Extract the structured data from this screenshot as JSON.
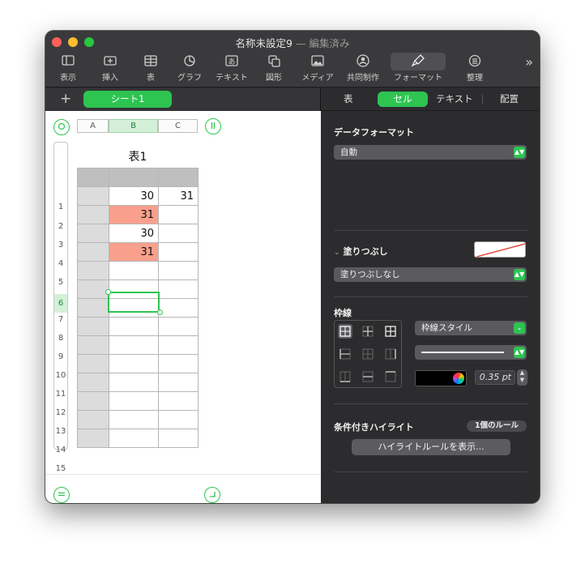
{
  "window": {
    "title": "名称未設定9",
    "title_suffix": " — 編集済み"
  },
  "toolbar": {
    "items": [
      {
        "label": "表示",
        "icon": "sidebar-view-icon"
      },
      {
        "label": "挿入",
        "icon": "insert-icon"
      },
      {
        "label": "表",
        "icon": "table-icon"
      },
      {
        "label": "グラフ",
        "icon": "chart-icon"
      },
      {
        "label": "テキスト",
        "icon": "text-icon"
      },
      {
        "label": "図形",
        "icon": "shape-icon"
      },
      {
        "label": "メディア",
        "icon": "media-icon"
      },
      {
        "label": "共同制作",
        "icon": "collaborate-icon"
      },
      {
        "label": "フォーマット",
        "icon": "format-brush-icon"
      },
      {
        "label": "整理",
        "icon": "organize-icon"
      }
    ],
    "more": "»"
  },
  "sheets": {
    "add": "+",
    "active_sheet": "シート1"
  },
  "table": {
    "title": "表1",
    "columns": [
      "A",
      "B",
      "C"
    ],
    "selected_column": "B",
    "rows": [
      "1",
      "2",
      "3",
      "4",
      "5",
      "6",
      "7",
      "8",
      "9",
      "10",
      "11",
      "12",
      "13",
      "14",
      "15"
    ],
    "selected_row": "6",
    "cells": [
      [
        "",
        "",
        ""
      ],
      [
        "",
        "30",
        "31"
      ],
      [
        "",
        "31",
        ""
      ],
      [
        "",
        "30",
        ""
      ],
      [
        "",
        "31",
        ""
      ],
      [
        "",
        "",
        ""
      ],
      [
        "",
        "",
        ""
      ],
      [
        "",
        "",
        ""
      ],
      [
        "",
        "",
        ""
      ],
      [
        "",
        "",
        ""
      ],
      [
        "",
        "",
        ""
      ],
      [
        "",
        "",
        ""
      ],
      [
        "",
        "",
        ""
      ],
      [
        "",
        "",
        ""
      ],
      [
        "",
        "",
        ""
      ]
    ],
    "highlighted_cells": [
      "B3",
      "B5"
    ],
    "highlight_color": "#f9a08c"
  },
  "inspector": {
    "tabs": [
      "表",
      "セル",
      "テキスト",
      "配置"
    ],
    "active_tab": "セル",
    "data_format": {
      "label": "データフォーマット",
      "value": "自動"
    },
    "fill": {
      "label": "塗りつぶし",
      "value": "塗りつぶしなし"
    },
    "border": {
      "label": "枠線",
      "style": "枠線スタイル",
      "width": "0.35 pt",
      "color": "#000000"
    },
    "conditional": {
      "label": "条件付きハイライト",
      "badge": "1個のルール",
      "button": "ハイライトルールを表示..."
    }
  },
  "colors": {
    "accent": "#2ec451",
    "toolbar_bg": "#3a3a3c",
    "inspector_bg": "#2c2c2e"
  }
}
